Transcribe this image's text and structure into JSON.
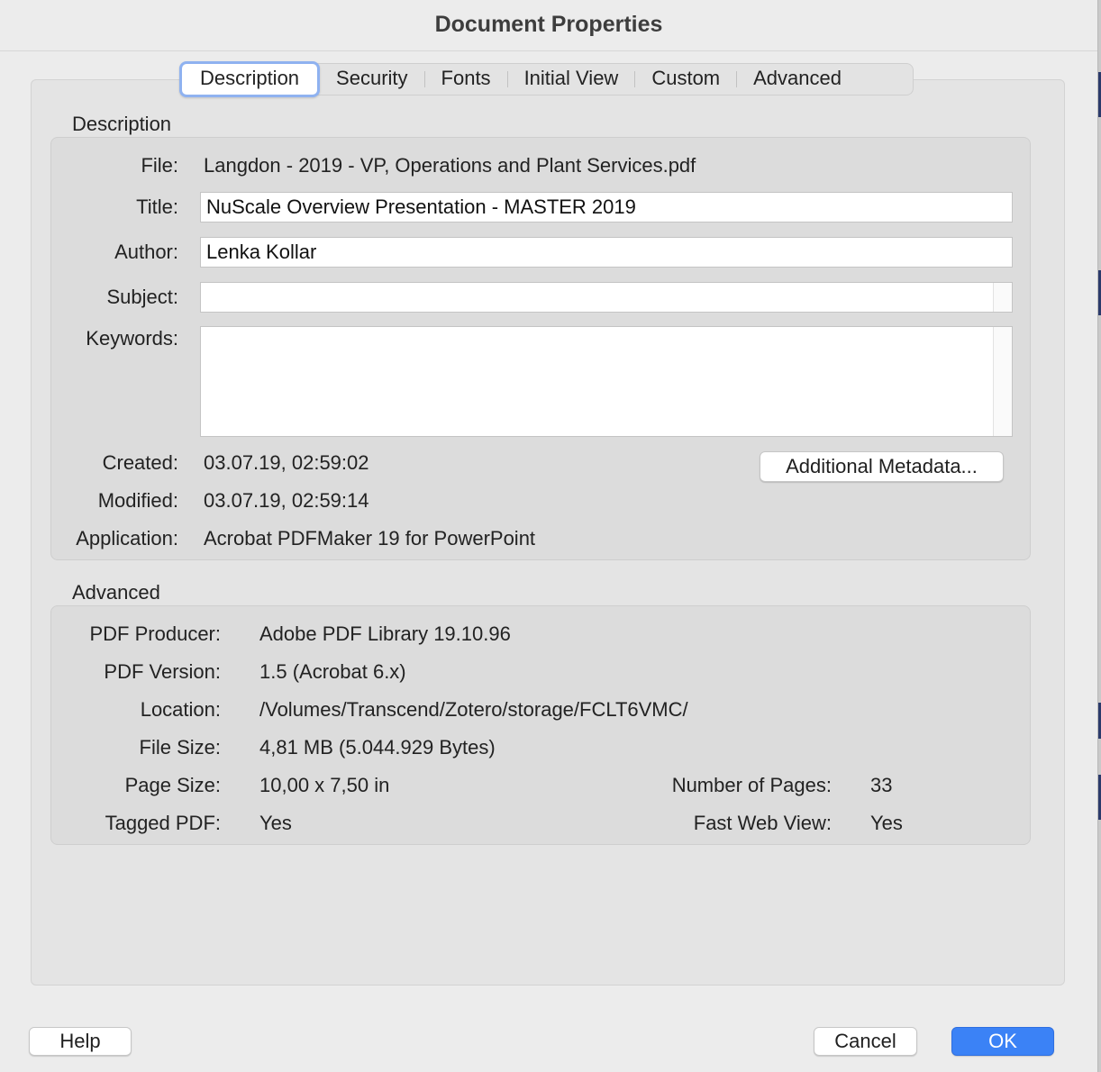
{
  "window": {
    "title": "Document Properties"
  },
  "tabs": [
    {
      "label": "Description",
      "selected": true
    },
    {
      "label": "Security",
      "selected": false
    },
    {
      "label": "Fonts",
      "selected": false
    },
    {
      "label": "Initial View",
      "selected": false
    },
    {
      "label": "Custom",
      "selected": false
    },
    {
      "label": "Advanced",
      "selected": false
    }
  ],
  "description": {
    "section_label": "Description",
    "file_label": "File:",
    "file_value": "Langdon - 2019 - VP, Operations and Plant Services.pdf",
    "title_label": "Title:",
    "title_value": "NuScale Overview Presentation - MASTER 2019",
    "author_label": "Author:",
    "author_value": "Lenka Kollar",
    "subject_label": "Subject:",
    "subject_value": "",
    "keywords_label": "Keywords:",
    "keywords_value": "",
    "created_label": "Created:",
    "created_value": "03.07.19, 02:59:02",
    "modified_label": "Modified:",
    "modified_value": "03.07.19, 02:59:14",
    "application_label": "Application:",
    "application_value": "Acrobat PDFMaker 19 for PowerPoint",
    "metadata_button": "Additional Metadata..."
  },
  "advanced": {
    "section_label": "Advanced",
    "producer_label": "PDF Producer:",
    "producer_value": "Adobe PDF Library 19.10.96",
    "version_label": "PDF Version:",
    "version_value": "1.5 (Acrobat 6.x)",
    "location_label": "Location:",
    "location_value": "/Volumes/Transcend/Zotero/storage/FCLT6VMC/",
    "filesize_label": "File Size:",
    "filesize_value": "4,81 MB (5.044.929 Bytes)",
    "pagesize_label": "Page Size:",
    "pagesize_value": "10,00 x 7,50 in",
    "numpages_label": "Number of Pages:",
    "numpages_value": "33",
    "tagged_label": "Tagged PDF:",
    "tagged_value": "Yes",
    "fastweb_label": "Fast Web View:",
    "fastweb_value": "Yes"
  },
  "buttons": {
    "help": "Help",
    "cancel": "Cancel",
    "ok": "OK"
  },
  "colors": {
    "accent": "#3b82f6",
    "tab_focus_ring": "#8fb2f0"
  }
}
